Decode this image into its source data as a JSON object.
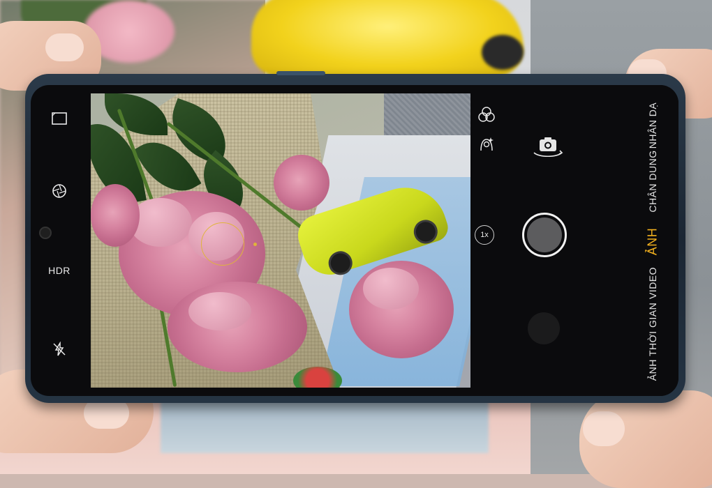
{
  "camera": {
    "left_controls": {
      "hdr_label": "HDR"
    },
    "zoom_label": "1x",
    "modes": [
      {
        "label": "NHÂN DẠ",
        "active": false
      },
      {
        "label": "CHÂN DUNG",
        "active": false
      },
      {
        "label": "ẢNH",
        "active": true
      },
      {
        "label": "VIDEO",
        "active": false
      },
      {
        "label": "ẢNH THỜI GIAN",
        "active": false
      }
    ],
    "accent_color": "#f2b01e",
    "icons": [
      "aspect-ratio-icon",
      "filter-aperture-icon",
      "flash-off-icon",
      "filters-icon",
      "beauty-icon",
      "switch-camera-icon"
    ]
  }
}
